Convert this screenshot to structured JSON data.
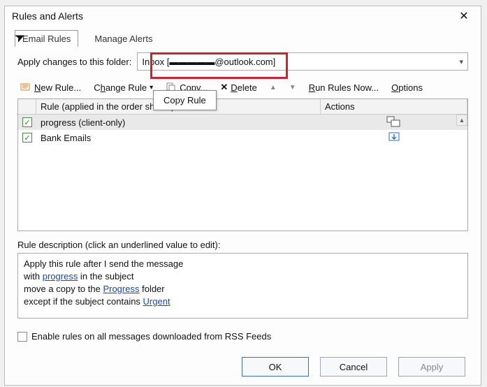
{
  "window": {
    "title": "Rules and Alerts"
  },
  "tabs": {
    "email_rules": "Email Rules",
    "manage_alerts": "Manage Alerts"
  },
  "folder": {
    "label": "Apply changes to this folder:",
    "value": "Inbox [▬▬▬▬▬@outlook.com]"
  },
  "toolbar": {
    "new_rule": "New Rule...",
    "change_rule": "Change Rule",
    "copy": "Copy...",
    "delete": "Delete",
    "run_rules": "Run Rules Now...",
    "options": "Options"
  },
  "tooltip": {
    "copy_rule": "Copy Rule"
  },
  "grid": {
    "header_rule": "Rule (applied in the order shown)",
    "header_actions": "Actions",
    "rows": [
      {
        "checked": true,
        "name": "progress  (client-only)",
        "action_icon": "copy-to-folder"
      },
      {
        "checked": true,
        "name": "Bank Emails",
        "action_icon": "move-to-folder"
      }
    ]
  },
  "description": {
    "label": "Rule description (click an underlined value to edit):",
    "line1_a": "Apply this rule after I send the message",
    "line2_a": "with ",
    "line2_link": "progress",
    "line2_b": " in the subject",
    "line3_a": "move a copy to the ",
    "line3_link": "Progress",
    "line3_b": " folder",
    "line4_a": "except if the subject contains ",
    "line4_link": "Urgent"
  },
  "rss": {
    "label": "Enable rules on all messages downloaded from RSS Feeds"
  },
  "buttons": {
    "ok": "OK",
    "cancel": "Cancel",
    "apply": "Apply"
  }
}
